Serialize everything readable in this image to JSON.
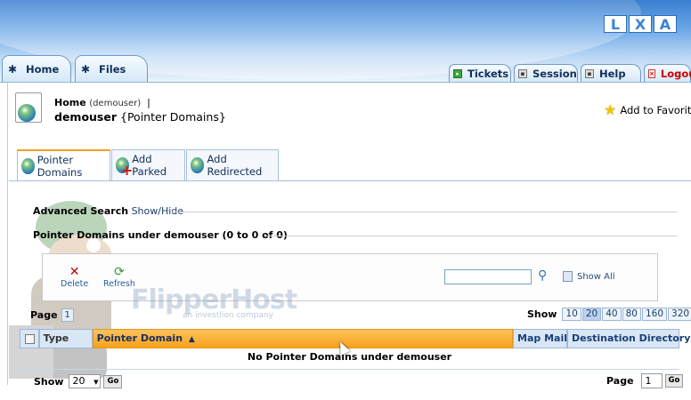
{
  "logo": {
    "letters": [
      "L",
      "X",
      "A"
    ]
  },
  "tabs": [
    {
      "label": "Home",
      "icon": "home-icon"
    },
    {
      "label": "Files",
      "icon": "files-icon"
    }
  ],
  "right_tabs": [
    {
      "label": "Tickets",
      "icon": "tickets-icon"
    },
    {
      "label": "Session",
      "icon": "session-icon"
    },
    {
      "label": "Help",
      "icon": "help-icon"
    },
    {
      "label": "Logout",
      "icon": "logout-icon"
    }
  ],
  "breadcrumb": {
    "home": "Home",
    "sub": "(demouser)",
    "sep": "|"
  },
  "page": {
    "user": "demouser",
    "section": "{Pointer Domains}"
  },
  "favorites": {
    "label": "Add to Favorites"
  },
  "subtabs": [
    {
      "label": "Pointer Domains"
    },
    {
      "label": "Add Parked"
    },
    {
      "label": "Add Redirected"
    }
  ],
  "advanced_search": {
    "label": "Advanced Search",
    "toggle": "Show/Hide"
  },
  "list_title": "Pointer Domains under demouser (0 to 0 of 0)",
  "actions": {
    "delete": "Delete",
    "refresh": "Refresh",
    "show_all": "Show All",
    "search_value": ""
  },
  "watermark": {
    "brand": "FlipperHost",
    "tagline": "an investlion company"
  },
  "pager": {
    "label": "Page",
    "current": "1"
  },
  "show": {
    "label": "Show",
    "options": [
      "10",
      "20",
      "40",
      "80",
      "160",
      "320"
    ],
    "selected": "20"
  },
  "table": {
    "columns": [
      "Type",
      "Pointer Domain",
      "Map Mail",
      "Destination Directory"
    ],
    "sort_indicator": "▲",
    "empty_message": "No Pointer Domains under demouser"
  },
  "bottom": {
    "show_label": "Show",
    "show_value": "20",
    "go": "Go",
    "page_label": "Page",
    "page_value": "1",
    "page_go": "Go"
  }
}
